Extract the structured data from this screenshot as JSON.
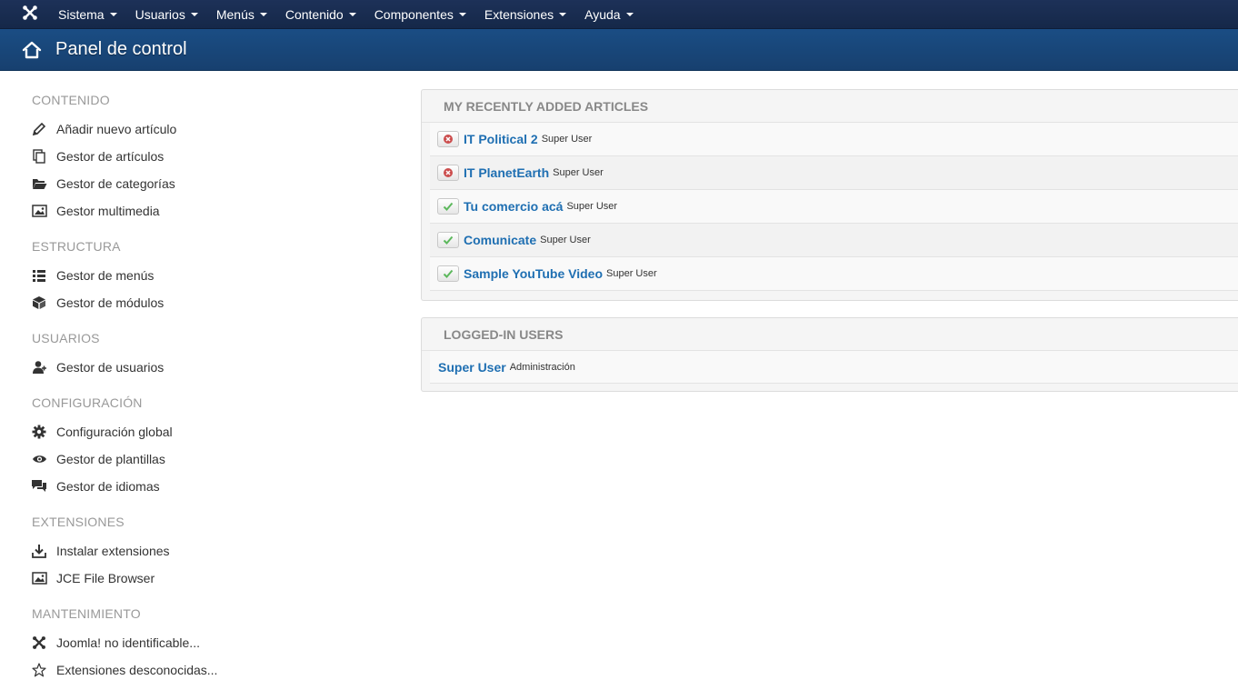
{
  "topnav": {
    "logo_icon": "joomla-icon",
    "items": [
      {
        "label": "Sistema"
      },
      {
        "label": "Usuarios"
      },
      {
        "label": "Menús"
      },
      {
        "label": "Contenido"
      },
      {
        "label": "Componentes"
      },
      {
        "label": "Extensiones"
      },
      {
        "label": "Ayuda"
      }
    ]
  },
  "header": {
    "icon": "home-icon",
    "title": "Panel de control"
  },
  "sidebar": {
    "sections": [
      {
        "title": "CONTENIDO",
        "items": [
          {
            "label": "Añadir nuevo artículo",
            "icon": "pencil-icon"
          },
          {
            "label": "Gestor de artículos",
            "icon": "copy-icon"
          },
          {
            "label": "Gestor de categorías",
            "icon": "folder-open-icon"
          },
          {
            "label": "Gestor multimedia",
            "icon": "image-icon"
          }
        ]
      },
      {
        "title": "ESTRUCTURA",
        "items": [
          {
            "label": "Gestor de menús",
            "icon": "list-icon"
          },
          {
            "label": "Gestor de módulos",
            "icon": "cube-icon"
          }
        ]
      },
      {
        "title": "USUARIOS",
        "items": [
          {
            "label": "Gestor de usuarios",
            "icon": "users-icon"
          }
        ]
      },
      {
        "title": "CONFIGURACIÓN",
        "items": [
          {
            "label": "Configuración global",
            "icon": "gear-icon"
          },
          {
            "label": "Gestor de plantillas",
            "icon": "eye-icon"
          },
          {
            "label": "Gestor de idiomas",
            "icon": "comments-icon"
          }
        ]
      },
      {
        "title": "EXTENSIONES",
        "items": [
          {
            "label": "Instalar extensiones",
            "icon": "download-icon"
          },
          {
            "label": "JCE File Browser",
            "icon": "image-icon"
          }
        ]
      },
      {
        "title": "MANTENIMIENTO",
        "items": [
          {
            "label": "Joomla! no identificable...",
            "icon": "joomla-icon"
          },
          {
            "label": "Extensiones desconocidas...",
            "icon": "star-icon"
          }
        ]
      }
    ]
  },
  "recent_articles": {
    "title": "MY RECENTLY ADDED ARTICLES",
    "rows": [
      {
        "title": "IT Political 2",
        "author": "Super User",
        "status": "unpublished",
        "status_icon": "unpublished-icon"
      },
      {
        "title": "IT PlanetEarth",
        "author": "Super User",
        "status": "unpublished",
        "status_icon": "unpublished-icon"
      },
      {
        "title": "Tu comercio acá",
        "author": "Super User",
        "status": "published",
        "status_icon": "published-check-icon"
      },
      {
        "title": "Comunicate",
        "author": "Super User",
        "status": "published",
        "status_icon": "published-check-icon"
      },
      {
        "title": "Sample YouTube Video",
        "author": "Super User",
        "status": "published",
        "status_icon": "published-check-icon"
      }
    ]
  },
  "logged_in_users": {
    "title": "LOGGED-IN USERS",
    "rows": [
      {
        "name": "Super User",
        "role": "Administración"
      }
    ]
  },
  "colors": {
    "navbar": "#1a2f55",
    "header": "#184776",
    "link": "#1f6fb2",
    "unpublished": "#cc4e4e",
    "published": "#5cb85c"
  }
}
